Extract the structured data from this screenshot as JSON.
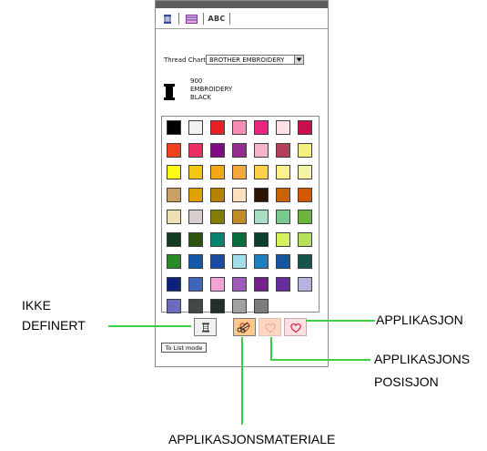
{
  "tabs": [
    {
      "label": "ABC"
    }
  ],
  "thread_chart": {
    "label": "Thread Chart:",
    "value": "BROTHER EMBROIDERY"
  },
  "current_thread": {
    "number": "900",
    "line1": "EMBROIDERY",
    "line2": "BLACK",
    "color": "#000000"
  },
  "swatch_colors": [
    "#000000",
    "#f2f2f2",
    "#e8202a",
    "#f48cb4",
    "#e8287c",
    "#fce0e6",
    "#c8104c",
    "#f0401c",
    "#ec3064",
    "#800a80",
    "#962c8c",
    "#f4b4cc",
    "#b4405c",
    "#f4f080",
    "#fcfc14",
    "#f0c814",
    "#f4a818",
    "#f4a83c",
    "#fcd048",
    "#fcf08c",
    "#f4f4a4",
    "#c8a064",
    "#e0a000",
    "#b48400",
    "#fce0c0",
    "#2c1400",
    "#c86400",
    "#d45800",
    "#ece0b4",
    "#d8cccc",
    "#847c04",
    "#c08c28",
    "#a8dcc4",
    "#78c890",
    "#6cb43c",
    "#143c24",
    "#2c5410",
    "#088470",
    "#086c3c",
    "#0c3c30",
    "#d4f05c",
    "#b4e05c",
    "#2c8828",
    "#1458a8",
    "#1c4ca4",
    "#a4dce8",
    "#1c80c0",
    "#1854a0",
    "#18544c",
    "#0c207c",
    "#4064bc",
    "#f0a4d8",
    "#9c5cb8",
    "#702488",
    "#642c9c",
    "#b4b4dc",
    "#6c6cb8",
    "#404848",
    "#242c2c",
    "#a0a0a0",
    "#7c7c7c"
  ],
  "to_list_label": "To List mode",
  "callouts": {
    "ikke_line1": "IKKE",
    "ikke_line2": "DEFINERT",
    "applikasjon": "APPLIKASJON",
    "pos_line1": "APPLIKASJONS",
    "pos_line2": "POSISJON",
    "materiale": "APPLIKASJONSMATERIALE"
  },
  "colors": {
    "callout_line": "#3ecf3e",
    "panel_border": "#8c8c8c"
  }
}
